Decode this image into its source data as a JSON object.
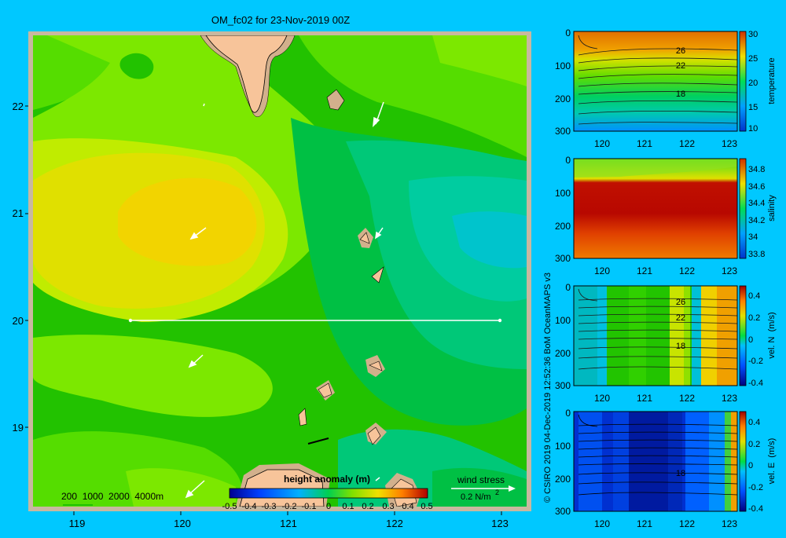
{
  "map": {
    "title": "OM_fc02 for 23-Nov-2019 00Z",
    "lat_ticks": [
      "22",
      "21",
      "20",
      "19"
    ],
    "lon_ticks": [
      "119",
      "120",
      "121",
      "122",
      "123"
    ],
    "colorbar_label": "height anomaly (m)",
    "colorbar_ticks": [
      "-0.5",
      "-0.4",
      "-0.3",
      "-0.2",
      "-0.1",
      "0",
      "0.1",
      "0.2",
      "0.3",
      "0.4",
      "0.5"
    ],
    "depth_legend": "200  1000  2000  4000m",
    "wind_label": "wind stress",
    "wind_scale": "0.2 N/m",
    "wind_scale_exp": "2",
    "credit": "© CSIRO 2019   04-Dec-2019 12:52:36 BoM OceanMAPS v3",
    "colors": {
      "background": "#00c8ff",
      "land": "#f7c49a",
      "shelf": "#d2b08c"
    }
  },
  "sections": [
    {
      "id": "temperature",
      "cbar_label": "temperature",
      "cbar_ticks": [
        "30",
        "25",
        "20",
        "15",
        "10"
      ],
      "contour_labels": [
        "26",
        "22",
        "18"
      ]
    },
    {
      "id": "salinity",
      "cbar_label": "salinity",
      "cbar_ticks": [
        "34.8",
        "34.6",
        "34.4",
        "34.2",
        "34",
        "33.8"
      ],
      "contour_labels": []
    },
    {
      "id": "veln",
      "cbar_label": "vel. N  (m/s)",
      "cbar_ticks": [
        "0.4",
        "0.2",
        "0",
        "-0.2",
        "-0.4"
      ],
      "contour_labels": [
        "26",
        "22",
        "18"
      ]
    },
    {
      "id": "vele",
      "cbar_label": "vel. E  (m/s)",
      "cbar_ticks": [
        "0.4",
        "0.2",
        "0",
        "-0.2",
        "-0.4"
      ],
      "contour_labels": [
        "18"
      ]
    }
  ],
  "section_axes": {
    "depth_ticks": [
      "0",
      "100",
      "200",
      "300"
    ],
    "lon_ticks": [
      "120",
      "121",
      "122",
      "123"
    ]
  }
}
